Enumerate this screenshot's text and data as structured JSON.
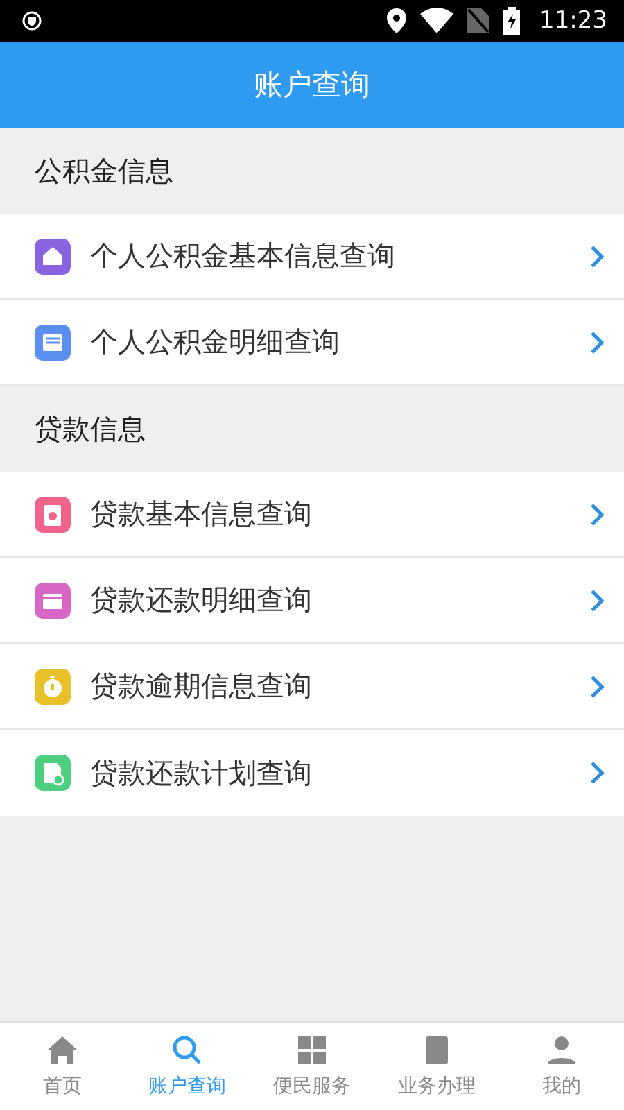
{
  "status_bar": {
    "time": "11:23"
  },
  "header": {
    "title": "账户查询"
  },
  "sections": [
    {
      "title": "公积金信息",
      "items": [
        {
          "label": "个人公积金基本信息查询",
          "kind": "house",
          "color": "#8a63e0"
        },
        {
          "label": "个人公积金明细查询",
          "kind": "doc",
          "color": "#5b8ef0"
        }
      ]
    },
    {
      "title": "贷款信息",
      "items": [
        {
          "label": "贷款基本信息查询",
          "kind": "clip",
          "color": "#f0648c"
        },
        {
          "label": "贷款还款明细查询",
          "kind": "card",
          "color": "#d866c4"
        },
        {
          "label": "贷款逾期信息查询",
          "kind": "timer",
          "color": "#e8c02a"
        },
        {
          "label": "贷款还款计划查询",
          "kind": "plan",
          "color": "#4ccf7f"
        }
      ]
    }
  ],
  "tabs": [
    {
      "label": "首页",
      "kind": "home",
      "selected": false
    },
    {
      "label": "账户查询",
      "kind": "search",
      "selected": true
    },
    {
      "label": "便民服务",
      "kind": "grid",
      "selected": false
    },
    {
      "label": "业务办理",
      "kind": "doc",
      "selected": false
    },
    {
      "label": "我的",
      "kind": "user",
      "selected": false
    }
  ]
}
